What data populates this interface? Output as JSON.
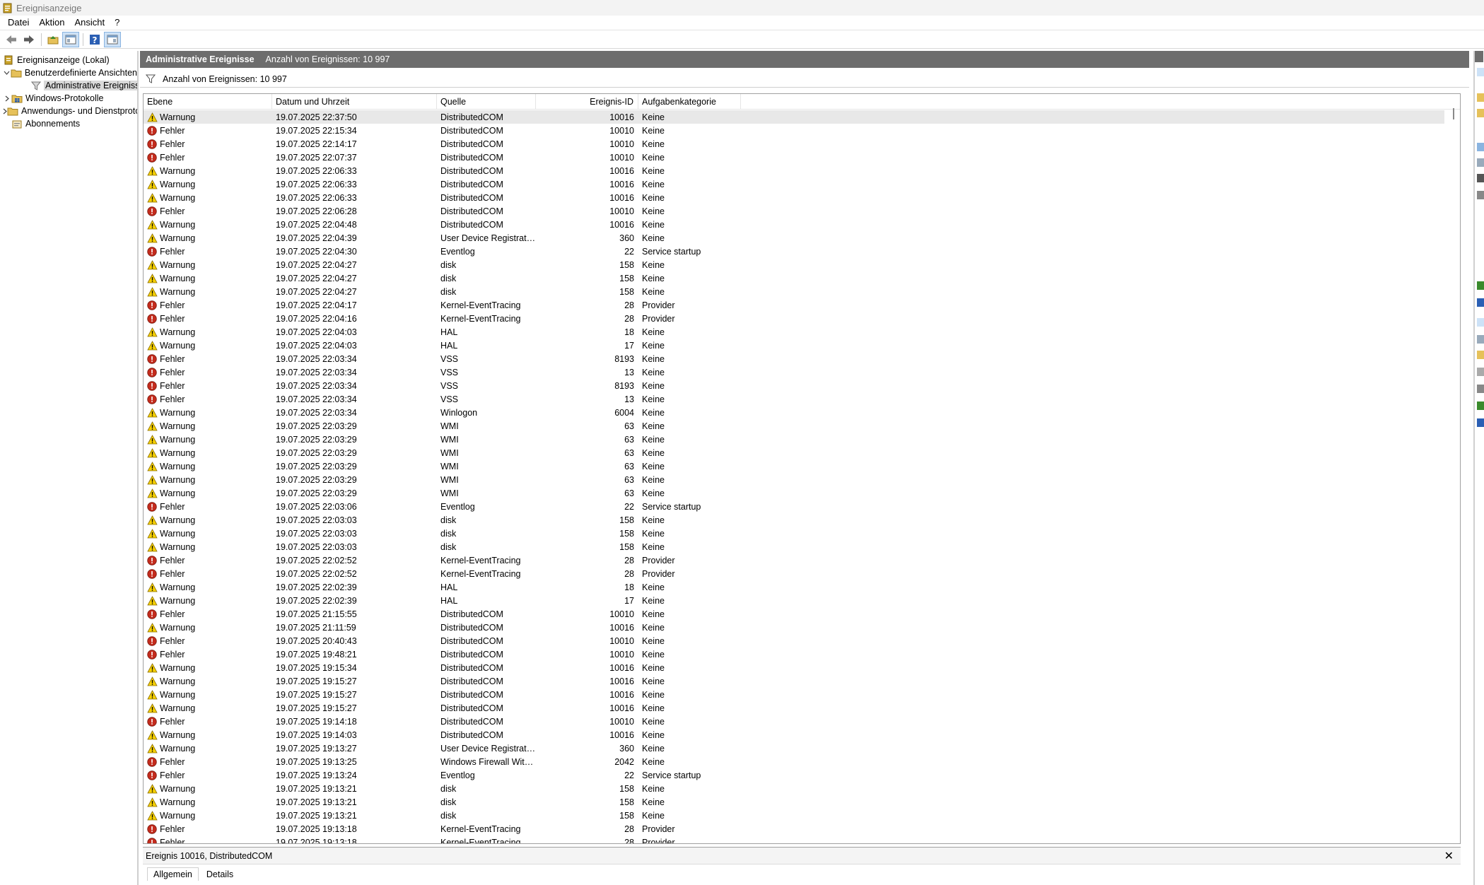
{
  "window": {
    "title": "Ereignisanzeige"
  },
  "menu": [
    "Datei",
    "Aktion",
    "Ansicht",
    "?"
  ],
  "tree": {
    "root": "Ereignisanzeige (Lokal)",
    "custom_views": "Benutzerdefinierte Ansichten",
    "admin_events": "Administrative Ereignisse",
    "windows_logs": "Windows-Protokolle",
    "app_service_logs": "Anwendungs- und Dienstprotokolle",
    "subscriptions": "Abonnements"
  },
  "main": {
    "header_title": "Administrative Ereignisse",
    "header_count": "Anzahl von Ereignissen: 10 997",
    "filter_text": "Anzahl von Ereignissen: 10 997"
  },
  "columns": {
    "level": "Ebene",
    "date": "Datum und Uhrzeit",
    "source": "Quelle",
    "event_id": "Ereignis-ID",
    "category": "Aufgabenkategorie"
  },
  "rows": [
    {
      "level": "Warnung",
      "date": "19.07.2025 22:37:50",
      "source": "DistributedCOM",
      "id": "10016",
      "cat": "Keine"
    },
    {
      "level": "Fehler",
      "date": "19.07.2025 22:15:34",
      "source": "DistributedCOM",
      "id": "10010",
      "cat": "Keine"
    },
    {
      "level": "Fehler",
      "date": "19.07.2025 22:14:17",
      "source": "DistributedCOM",
      "id": "10010",
      "cat": "Keine"
    },
    {
      "level": "Fehler",
      "date": "19.07.2025 22:07:37",
      "source": "DistributedCOM",
      "id": "10010",
      "cat": "Keine"
    },
    {
      "level": "Warnung",
      "date": "19.07.2025 22:06:33",
      "source": "DistributedCOM",
      "id": "10016",
      "cat": "Keine"
    },
    {
      "level": "Warnung",
      "date": "19.07.2025 22:06:33",
      "source": "DistributedCOM",
      "id": "10016",
      "cat": "Keine"
    },
    {
      "level": "Warnung",
      "date": "19.07.2025 22:06:33",
      "source": "DistributedCOM",
      "id": "10016",
      "cat": "Keine"
    },
    {
      "level": "Fehler",
      "date": "19.07.2025 22:06:28",
      "source": "DistributedCOM",
      "id": "10010",
      "cat": "Keine"
    },
    {
      "level": "Warnung",
      "date": "19.07.2025 22:04:48",
      "source": "DistributedCOM",
      "id": "10016",
      "cat": "Keine"
    },
    {
      "level": "Warnung",
      "date": "19.07.2025 22:04:39",
      "source": "User Device Registration",
      "id": "360",
      "cat": "Keine"
    },
    {
      "level": "Fehler",
      "date": "19.07.2025 22:04:30",
      "source": "Eventlog",
      "id": "22",
      "cat": "Service startup"
    },
    {
      "level": "Warnung",
      "date": "19.07.2025 22:04:27",
      "source": "disk",
      "id": "158",
      "cat": "Keine"
    },
    {
      "level": "Warnung",
      "date": "19.07.2025 22:04:27",
      "source": "disk",
      "id": "158",
      "cat": "Keine"
    },
    {
      "level": "Warnung",
      "date": "19.07.2025 22:04:27",
      "source": "disk",
      "id": "158",
      "cat": "Keine"
    },
    {
      "level": "Fehler",
      "date": "19.07.2025 22:04:17",
      "source": "Kernel-EventTracing",
      "id": "28",
      "cat": "Provider"
    },
    {
      "level": "Fehler",
      "date": "19.07.2025 22:04:16",
      "source": "Kernel-EventTracing",
      "id": "28",
      "cat": "Provider"
    },
    {
      "level": "Warnung",
      "date": "19.07.2025 22:04:03",
      "source": "HAL",
      "id": "18",
      "cat": "Keine"
    },
    {
      "level": "Warnung",
      "date": "19.07.2025 22:04:03",
      "source": "HAL",
      "id": "17",
      "cat": "Keine"
    },
    {
      "level": "Fehler",
      "date": "19.07.2025 22:03:34",
      "source": "VSS",
      "id": "8193",
      "cat": "Keine"
    },
    {
      "level": "Fehler",
      "date": "19.07.2025 22:03:34",
      "source": "VSS",
      "id": "13",
      "cat": "Keine"
    },
    {
      "level": "Fehler",
      "date": "19.07.2025 22:03:34",
      "source": "VSS",
      "id": "8193",
      "cat": "Keine"
    },
    {
      "level": "Fehler",
      "date": "19.07.2025 22:03:34",
      "source": "VSS",
      "id": "13",
      "cat": "Keine"
    },
    {
      "level": "Warnung",
      "date": "19.07.2025 22:03:34",
      "source": "Winlogon",
      "id": "6004",
      "cat": "Keine"
    },
    {
      "level": "Warnung",
      "date": "19.07.2025 22:03:29",
      "source": "WMI",
      "id": "63",
      "cat": "Keine"
    },
    {
      "level": "Warnung",
      "date": "19.07.2025 22:03:29",
      "source": "WMI",
      "id": "63",
      "cat": "Keine"
    },
    {
      "level": "Warnung",
      "date": "19.07.2025 22:03:29",
      "source": "WMI",
      "id": "63",
      "cat": "Keine"
    },
    {
      "level": "Warnung",
      "date": "19.07.2025 22:03:29",
      "source": "WMI",
      "id": "63",
      "cat": "Keine"
    },
    {
      "level": "Warnung",
      "date": "19.07.2025 22:03:29",
      "source": "WMI",
      "id": "63",
      "cat": "Keine"
    },
    {
      "level": "Warnung",
      "date": "19.07.2025 22:03:29",
      "source": "WMI",
      "id": "63",
      "cat": "Keine"
    },
    {
      "level": "Fehler",
      "date": "19.07.2025 22:03:06",
      "source": "Eventlog",
      "id": "22",
      "cat": "Service startup"
    },
    {
      "level": "Warnung",
      "date": "19.07.2025 22:03:03",
      "source": "disk",
      "id": "158",
      "cat": "Keine"
    },
    {
      "level": "Warnung",
      "date": "19.07.2025 22:03:03",
      "source": "disk",
      "id": "158",
      "cat": "Keine"
    },
    {
      "level": "Warnung",
      "date": "19.07.2025 22:03:03",
      "source": "disk",
      "id": "158",
      "cat": "Keine"
    },
    {
      "level": "Fehler",
      "date": "19.07.2025 22:02:52",
      "source": "Kernel-EventTracing",
      "id": "28",
      "cat": "Provider"
    },
    {
      "level": "Fehler",
      "date": "19.07.2025 22:02:52",
      "source": "Kernel-EventTracing",
      "id": "28",
      "cat": "Provider"
    },
    {
      "level": "Warnung",
      "date": "19.07.2025 22:02:39",
      "source": "HAL",
      "id": "18",
      "cat": "Keine"
    },
    {
      "level": "Warnung",
      "date": "19.07.2025 22:02:39",
      "source": "HAL",
      "id": "17",
      "cat": "Keine"
    },
    {
      "level": "Fehler",
      "date": "19.07.2025 21:15:55",
      "source": "DistributedCOM",
      "id": "10010",
      "cat": "Keine"
    },
    {
      "level": "Warnung",
      "date": "19.07.2025 21:11:59",
      "source": "DistributedCOM",
      "id": "10016",
      "cat": "Keine"
    },
    {
      "level": "Fehler",
      "date": "19.07.2025 20:40:43",
      "source": "DistributedCOM",
      "id": "10010",
      "cat": "Keine"
    },
    {
      "level": "Fehler",
      "date": "19.07.2025 19:48:21",
      "source": "DistributedCOM",
      "id": "10010",
      "cat": "Keine"
    },
    {
      "level": "Warnung",
      "date": "19.07.2025 19:15:34",
      "source": "DistributedCOM",
      "id": "10016",
      "cat": "Keine"
    },
    {
      "level": "Warnung",
      "date": "19.07.2025 19:15:27",
      "source": "DistributedCOM",
      "id": "10016",
      "cat": "Keine"
    },
    {
      "level": "Warnung",
      "date": "19.07.2025 19:15:27",
      "source": "DistributedCOM",
      "id": "10016",
      "cat": "Keine"
    },
    {
      "level": "Warnung",
      "date": "19.07.2025 19:15:27",
      "source": "DistributedCOM",
      "id": "10016",
      "cat": "Keine"
    },
    {
      "level": "Fehler",
      "date": "19.07.2025 19:14:18",
      "source": "DistributedCOM",
      "id": "10010",
      "cat": "Keine"
    },
    {
      "level": "Warnung",
      "date": "19.07.2025 19:14:03",
      "source": "DistributedCOM",
      "id": "10016",
      "cat": "Keine"
    },
    {
      "level": "Warnung",
      "date": "19.07.2025 19:13:27",
      "source": "User Device Registration",
      "id": "360",
      "cat": "Keine"
    },
    {
      "level": "Fehler",
      "date": "19.07.2025 19:13:25",
      "source": "Windows Firewall With...",
      "id": "2042",
      "cat": "Keine"
    },
    {
      "level": "Fehler",
      "date": "19.07.2025 19:13:24",
      "source": "Eventlog",
      "id": "22",
      "cat": "Service startup"
    },
    {
      "level": "Warnung",
      "date": "19.07.2025 19:13:21",
      "source": "disk",
      "id": "158",
      "cat": "Keine"
    },
    {
      "level": "Warnung",
      "date": "19.07.2025 19:13:21",
      "source": "disk",
      "id": "158",
      "cat": "Keine"
    },
    {
      "level": "Warnung",
      "date": "19.07.2025 19:13:21",
      "source": "disk",
      "id": "158",
      "cat": "Keine"
    },
    {
      "level": "Fehler",
      "date": "19.07.2025 19:13:18",
      "source": "Kernel-EventTracing",
      "id": "28",
      "cat": "Provider"
    },
    {
      "level": "Fehler",
      "date": "19.07.2025 19:13:18",
      "source": "Kernel-EventTracing",
      "id": "28",
      "cat": "Provider"
    }
  ],
  "detail": {
    "title": "Ereignis 10016, DistributedCOM",
    "tab_general": "Allgemein",
    "tab_details": "Details"
  },
  "colors": {
    "header_bg": "#6d6d6d",
    "warning_yellow": "#f7d100",
    "error_red": "#c42b1c",
    "selection": "#e8e8e8"
  }
}
